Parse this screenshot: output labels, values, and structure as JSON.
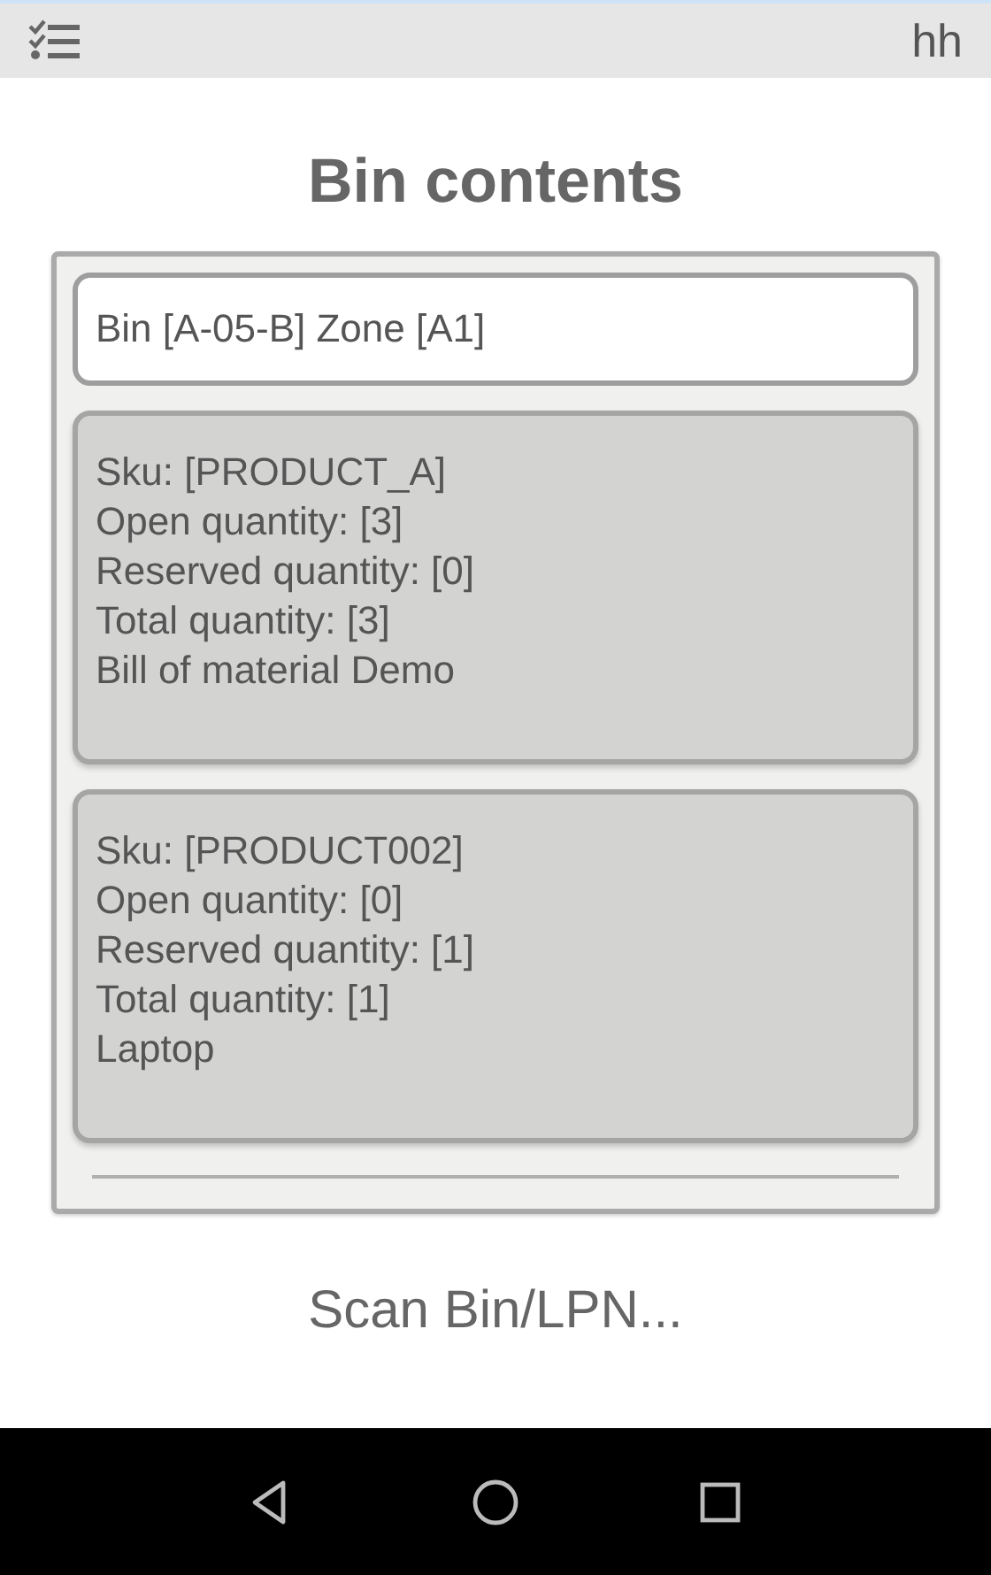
{
  "top_bar": {
    "user": "hh"
  },
  "title": "Bin contents",
  "bin_header": "Bin [A-05-B] Zone [A1]",
  "items": [
    {
      "lines": [
        "Sku: [PRODUCT_A]",
        "Open quantity: [3]",
        "Reserved quantity: [0]",
        "Total quantity: [3]",
        "Bill of material Demo"
      ]
    },
    {
      "lines": [
        "Sku: [PRODUCT002]",
        "Open quantity: [0]",
        "Reserved quantity: [1]",
        "Total quantity: [1]",
        "Laptop"
      ]
    }
  ],
  "scan_prompt": "Scan Bin/LPN..."
}
